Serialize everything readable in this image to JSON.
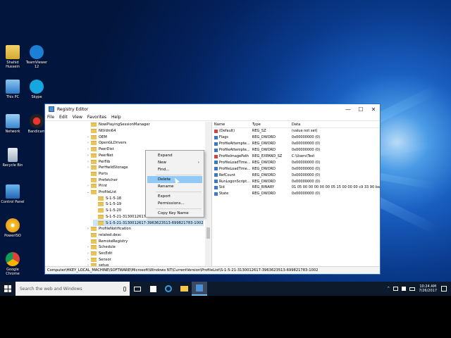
{
  "desktop": {
    "icons": [
      {
        "label": "Shahid Hussein"
      },
      {
        "label": "TeamViewer 12"
      },
      {
        "label": "This PC"
      },
      {
        "label": "Skype"
      },
      {
        "label": "Network"
      },
      {
        "label": "Bandicam"
      },
      {
        "label": "Recycle Bin"
      },
      {
        "label": "Control Panel"
      },
      {
        "label": "PowerISO"
      },
      {
        "label": "Google Chrome"
      }
    ]
  },
  "window": {
    "title": "Registry Editor",
    "minimize": "—",
    "maximize": "☐",
    "close": "✕",
    "menu": [
      "File",
      "Edit",
      "View",
      "Favorites",
      "Help"
    ],
    "tree": [
      {
        "label": "NowPlayingSessionManager",
        "expander": ""
      },
      {
        "label": "NtVdm64",
        "expander": ""
      },
      {
        "label": "OEM",
        "expander": "›"
      },
      {
        "label": "OpenGLDrivers",
        "expander": "›"
      },
      {
        "label": "PeerDist",
        "expander": "›"
      },
      {
        "label": "PeerNet",
        "expander": "›"
      },
      {
        "label": "Perflib",
        "expander": "›"
      },
      {
        "label": "PerHwIdStorage",
        "expander": "›"
      },
      {
        "label": "Ports",
        "expander": ""
      },
      {
        "label": "Prefetcher",
        "expander": ""
      },
      {
        "label": "Print",
        "expander": "›"
      },
      {
        "label": "ProfileList",
        "expander": "⌄"
      },
      {
        "label": "S-1-5-18",
        "expander": ""
      },
      {
        "label": "S-1-5-19",
        "expander": ""
      },
      {
        "label": "S-1-5-20",
        "expander": ""
      },
      {
        "label": "S-1-5-21-3130012617-396362",
        "expander": ""
      },
      {
        "label": "S-1-5-21-3130012617-3963623513-699821783-1002",
        "expander": ""
      },
      {
        "label": "ProfileNotification",
        "expander": "›"
      },
      {
        "label": "related.desc",
        "expander": ""
      },
      {
        "label": "RemoteRegistry",
        "expander": ""
      },
      {
        "label": "Schedule",
        "expander": "›"
      },
      {
        "label": "SecEdit",
        "expander": "›"
      },
      {
        "label": "Sensor",
        "expander": "›"
      },
      {
        "label": "setup",
        "expander": "›"
      }
    ],
    "values": {
      "headers": [
        "Name",
        "Type",
        "Data"
      ],
      "rows": [
        {
          "name": "(Default)",
          "type": "REG_SZ",
          "data": "(value not set)",
          "kind": "ab"
        },
        {
          "name": "Flags",
          "type": "REG_DWORD",
          "data": "0x00000000 (0)",
          "kind": "bin"
        },
        {
          "name": "ProfileAttempte...",
          "type": "REG_DWORD",
          "data": "0x00000000 (0)",
          "kind": "bin"
        },
        {
          "name": "ProfileAttempte...",
          "type": "REG_DWORD",
          "data": "0x00000000 (0)",
          "kind": "bin"
        },
        {
          "name": "ProfileImagePath",
          "type": "REG_EXPAND_SZ",
          "data": "C:\\Users\\Test",
          "kind": "ab"
        },
        {
          "name": "ProfileLoadTime...",
          "type": "REG_DWORD",
          "data": "0x00000000 (0)",
          "kind": "bin"
        },
        {
          "name": "ProfileLoadTime...",
          "type": "REG_DWORD",
          "data": "0x00000000 (0)",
          "kind": "bin"
        },
        {
          "name": "RefCount",
          "type": "REG_DWORD",
          "data": "0x00000000 (0)",
          "kind": "bin"
        },
        {
          "name": "RunLogonScript...",
          "type": "REG_DWORD",
          "data": "0x00000000 (0)",
          "kind": "bin"
        },
        {
          "name": "Sid",
          "type": "REG_BINARY",
          "data": "01 05 00 00 00 00 00 05 15 00 00 00 c9 33 90 ba",
          "kind": "bin"
        },
        {
          "name": "State",
          "type": "REG_DWORD",
          "data": "0x00000000 (0)",
          "kind": "bin"
        }
      ]
    },
    "status_path": "Computer\\HKEY_LOCAL_MACHINE\\SOFTWARE\\Microsoft\\Windows NT\\CurrentVersion\\ProfileList\\S-1-5-21-3130012617-3963623513-699821783-1002"
  },
  "context_menu": {
    "expand": "Expand",
    "new": "New",
    "new_arrow": "›",
    "find": "Find...",
    "delete": "Delete",
    "rename": "Rename",
    "export": "Export",
    "permissions": "Permissions...",
    "copy_key_name": "Copy Key Name"
  },
  "taskbar": {
    "search_placeholder": "Search the web and Windows",
    "time": "10:24 AM",
    "date": "7/26/2017",
    "tray_up": "^"
  }
}
